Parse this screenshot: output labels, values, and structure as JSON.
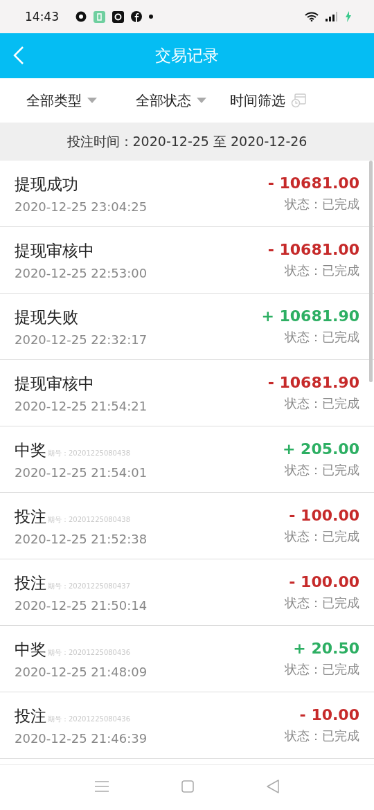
{
  "status_bar": {
    "time": "14:43"
  },
  "header": {
    "title": "交易记录"
  },
  "filters": [
    {
      "label": "全部类型",
      "kind": "dropdown"
    },
    {
      "label": "全部状态",
      "kind": "dropdown"
    },
    {
      "label": "时间筛选",
      "kind": "date"
    }
  ],
  "date_range": "投注时间：2020-12-25 至 2020-12-26",
  "records": [
    {
      "title": "提现成功",
      "date": "2020-12-25 23:04:25",
      "amount": "- 10681.00",
      "kind": "expense",
      "status": "状态：已完成"
    },
    {
      "title": "提现审核中",
      "date": "2020-12-25 22:53:00",
      "amount": "- 10681.00",
      "kind": "expense",
      "status": "状态：已完成"
    },
    {
      "title": "提现失败",
      "date": "2020-12-25 22:32:17",
      "amount": "+ 10681.90",
      "kind": "income",
      "status": "状态：已完成"
    },
    {
      "title": "提现审核中",
      "date": "2020-12-25 21:54:21",
      "amount": "- 10681.90",
      "kind": "expense",
      "status": "状态：已完成"
    },
    {
      "title": "中奖",
      "period": "期号：20201225080438",
      "date": "2020-12-25 21:54:01",
      "amount": "+ 205.00",
      "kind": "income",
      "status": "状态：已完成"
    },
    {
      "title": "投注",
      "period": "期号：20201225080438",
      "date": "2020-12-25 21:52:38",
      "amount": "- 100.00",
      "kind": "expense",
      "status": "状态：已完成"
    },
    {
      "title": "投注",
      "period": "期号：20201225080437",
      "date": "2020-12-25 21:50:14",
      "amount": "- 100.00",
      "kind": "expense",
      "status": "状态：已完成"
    },
    {
      "title": "中奖",
      "period": "期号：20201225080436",
      "date": "2020-12-25 21:48:09",
      "amount": "+ 20.50",
      "kind": "income",
      "status": "状态：已完成"
    },
    {
      "title": "投注",
      "period": "期号：20201225080436",
      "date": "2020-12-25 21:46:39",
      "amount": "- 10.00",
      "kind": "expense",
      "status": "状态：已完成"
    }
  ]
}
